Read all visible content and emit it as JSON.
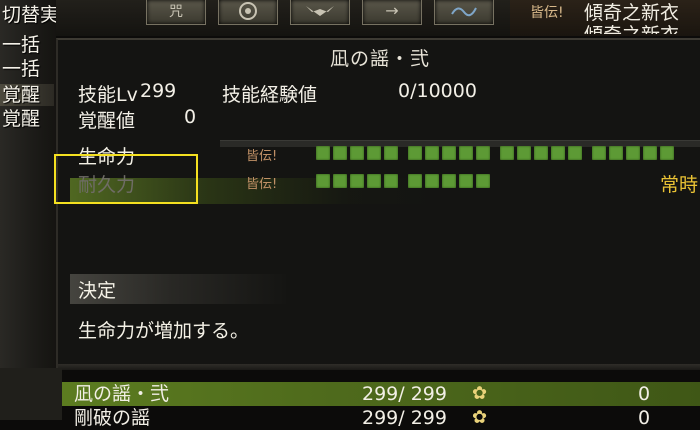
{
  "left_menu": {
    "items": [
      "切替実装",
      "一括",
      "一括",
      "覚醒",
      "覚醒"
    ]
  },
  "top_bar": {
    "icons": [
      "curse-skill-icon",
      "tomoe-icon",
      "bat-wing-icon",
      "arrow-right-icon",
      "wave-icon"
    ],
    "arrow_glyph": "→",
    "kaiden": "皆伝!",
    "equip_line1": "傾奇之新衣",
    "equip_line2": "傾奇之新衣"
  },
  "panel": {
    "title": "凪の謡・弐",
    "skill_lv_label": "技能Lv",
    "skill_lv_value": "299",
    "skill_exp_label": "技能経験値",
    "skill_exp_value": "0/10000",
    "awaken_label": "覚醒値",
    "awaken_value": "0",
    "skill_exp_progress": 0.0,
    "stats": [
      {
        "name": "生命力",
        "kaiden": "皆伝!",
        "pips": 20,
        "active": true
      },
      {
        "name": "耐久力",
        "kaiden": "皆伝!",
        "pips": 10,
        "active": false
      }
    ],
    "stat_tag": "常時",
    "decide_label": "決定",
    "description": "生命力が増加する。"
  },
  "skill_list": [
    {
      "name": "凪の謡・弐",
      "lv": "299/ 299",
      "value": "0",
      "selected": true
    },
    {
      "name": "剛破の謡",
      "lv": "299/ 299",
      "value": "0",
      "selected": false
    }
  ],
  "colors": {
    "pip_green": "#5d9a35",
    "highlight_yellow": "#f4e020",
    "kaiden_brown": "#c09066",
    "jouji_gold": "#e9c234",
    "selected_row_green": "#5c7c20"
  }
}
